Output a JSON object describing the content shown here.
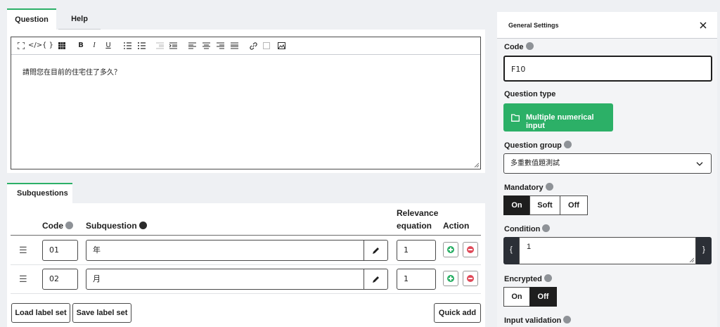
{
  "tabs": {
    "question": "Question",
    "help": "Help"
  },
  "editor": {
    "toolbar": [
      "maximize-icon",
      "source-code-icon",
      "braces-icon",
      "grid-icon",
      "bold-icon",
      "italic-icon",
      "underline-icon",
      "numbered-list-icon",
      "bulleted-list-icon",
      "outdent-icon",
      "indent-icon",
      "align-left-icon",
      "align-center-icon",
      "align-right-icon",
      "justify-icon",
      "link-icon",
      "unlink-icon",
      "image-icon"
    ],
    "labels": {
      "braces": "{ }",
      "bold": "B",
      "italic": "I",
      "underline": "U"
    },
    "content": "請問您在目前的住宅住了多久？"
  },
  "subquestions": {
    "tab": "Subquestions",
    "headers": {
      "code": "Code",
      "subquestion": "Subquestion",
      "relevance_1": "Relevance",
      "relevance_2": "equation",
      "action": "Action"
    },
    "rows": [
      {
        "code": "01",
        "text": "年",
        "relevance": "1"
      },
      {
        "code": "02",
        "text": "月",
        "relevance": "1"
      }
    ],
    "buttons": {
      "load": "Load label set",
      "save": "Save label set",
      "quick_add": "Quick add"
    }
  },
  "settings": {
    "title": "General Settings",
    "code_label": "Code",
    "code_value": "F10",
    "question_type_label": "Question type",
    "question_type_value": "Multiple numerical input",
    "question_group_label": "Question group",
    "question_group_value": "多重數值題測試",
    "mandatory_label": "Mandatory",
    "mandatory_options": [
      "On",
      "Soft",
      "Off"
    ],
    "mandatory_selected": "On",
    "condition_label": "Condition",
    "condition_value": "1",
    "condition_open": "{",
    "condition_close": "}",
    "encrypted_label": "Encrypted",
    "encrypted_options": [
      "On",
      "Off"
    ],
    "encrypted_selected": "Off",
    "input_validation_label": "Input validation"
  },
  "colors": {
    "accent": "#2cb067",
    "danger": "#e04b5a",
    "dark": "#1e1e1e"
  }
}
